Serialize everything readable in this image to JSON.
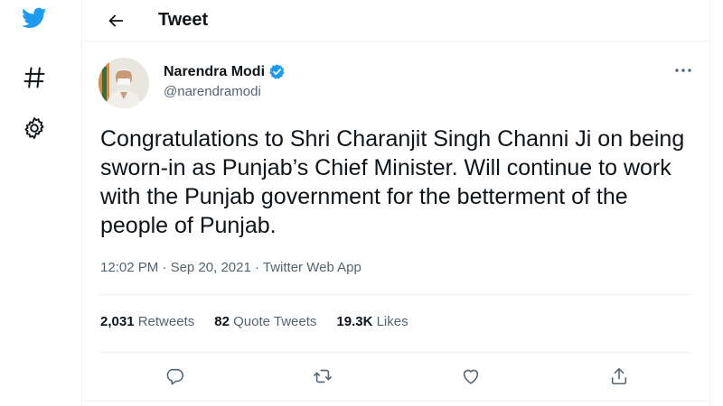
{
  "colors": {
    "brand": "#1d9bf0",
    "text": "#0f1419",
    "muted": "#536471",
    "border": "#eff3f4"
  },
  "sidebar": {
    "icons": [
      "twitter-logo-icon",
      "hashtag-icon",
      "settings-gear-icon"
    ]
  },
  "header": {
    "title": "Tweet",
    "back_icon": "arrow-left-icon"
  },
  "tweet": {
    "author": {
      "name": "Narendra Modi",
      "handle": "@narendramodi",
      "verified": true
    },
    "text": "Congratulations to Shri Charanjit Singh Channi Ji on being sworn-in as Punjab’s Chief Minister. Will continue to work with the Punjab government for the betterment of the people of Punjab.",
    "time": "12:02 PM",
    "date": "Sep 20, 2021",
    "separator": " · ",
    "source": "Twitter Web App",
    "stats": {
      "retweets_count": "2,031",
      "retweets_label": "Retweets",
      "quotes_count": "82",
      "quotes_label": "Quote Tweets",
      "likes_count": "19.3K",
      "likes_label": "Likes"
    },
    "actions": [
      "reply-icon",
      "retweet-icon",
      "like-icon",
      "share-icon"
    ]
  }
}
